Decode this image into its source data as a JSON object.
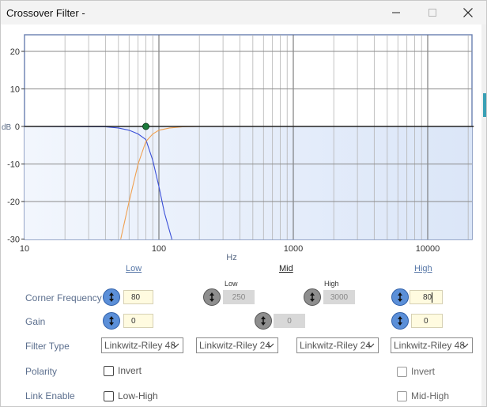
{
  "window": {
    "title": "Crossover Filter -",
    "min_icon": "minimize-icon",
    "max_icon": "maximize-icon",
    "close_icon": "close-icon"
  },
  "chart_data": {
    "type": "line",
    "xscale": "log",
    "xlim": [
      10,
      22000
    ],
    "ylim": [
      -30,
      25
    ],
    "xlabel": "Hz",
    "ylabel": "dB",
    "x_ticks": [
      "10",
      "100",
      "1000",
      "10000"
    ],
    "y_ticks": [
      "20",
      "10",
      "0",
      "-10",
      "-20",
      "-30"
    ],
    "grid": true,
    "series": [
      {
        "color": "#3a4fd8",
        "x": [
          10,
          40,
          50,
          60,
          70,
          80,
          90,
          100,
          110,
          125
        ],
        "y": [
          0,
          -0.1,
          -0.4,
          -1.0,
          -2.0,
          -3.5,
          -9,
          -16,
          -23,
          -31
        ]
      },
      {
        "color": "#f0a050",
        "x": [
          52,
          60,
          70,
          80,
          90,
          100,
          120,
          150,
          200,
          22000
        ],
        "y": [
          -30,
          -20,
          -10,
          -4,
          -2,
          -1,
          -0.4,
          -0.1,
          0,
          0
        ]
      },
      {
        "color": "#222222",
        "x": [
          10,
          22000
        ],
        "y": [
          0,
          0
        ]
      }
    ],
    "marker": {
      "x": 80,
      "y": 0,
      "color": "#1a7a3a"
    }
  },
  "bands": {
    "low": "Low",
    "mid": "Mid",
    "high": "High"
  },
  "labels": {
    "corner_frequency": "Corner Frequency",
    "gain": "Gain",
    "filter_type": "Filter Type",
    "polarity": "Polarity",
    "link_enable": "Link Enable",
    "mid_low": "Low",
    "mid_high": "High"
  },
  "values": {
    "low_freq": "80",
    "mid_low_freq": "250",
    "mid_high_freq": "3000",
    "high_freq": "80",
    "low_gain": "0",
    "mid_gain": "0",
    "high_gain": "0"
  },
  "filter_types": {
    "low": "Linkwitz-Riley 48",
    "mid_low": "Linkwitz-Riley 24",
    "mid_high": "Linkwitz-Riley 24",
    "high": "Linkwitz-Riley 48"
  },
  "checkboxes": {
    "polarity_low": "Invert",
    "polarity_high": "Invert",
    "link_low_high": "Low-High",
    "link_mid_high": "Mid-High"
  },
  "colors": {
    "accent": "#5b8fd8",
    "grid": "#8a8a8a",
    "plot_fill": "#dde8f8"
  }
}
